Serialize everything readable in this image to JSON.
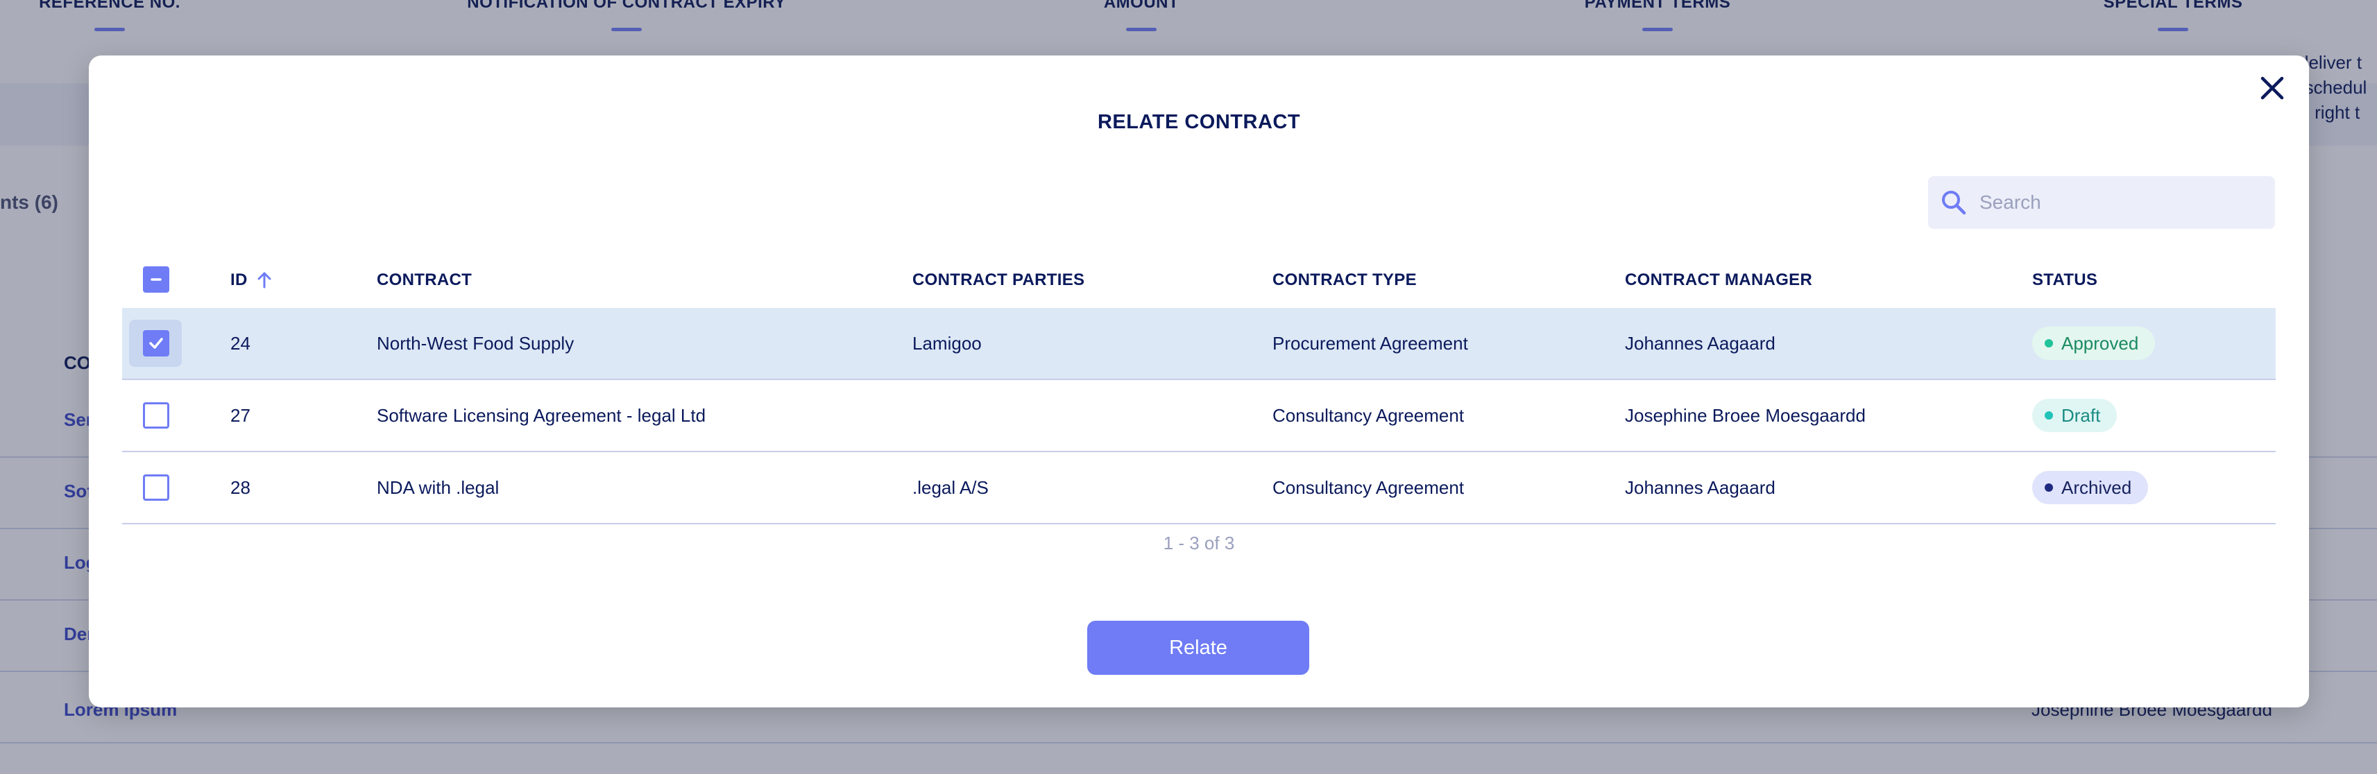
{
  "background": {
    "columns": [
      {
        "label": "REFERENCE NO.",
        "center": "158px"
      },
      {
        "label": "NOTIFICATION OF CONTRACT EXPIRY",
        "center": "903px"
      },
      {
        "label": "AMOUNT",
        "center": "1645px"
      },
      {
        "label": "PAYMENT TERMS",
        "center": "2389px"
      },
      {
        "label": "SPECIAL TERMS",
        "center": "3132px"
      }
    ],
    "special_terms_lines": [
      "l deliver t",
      "d schedul",
      "he right t"
    ],
    "tab_label": "nts (6)",
    "table_col_header": "CO",
    "row_links": [
      "Sen",
      "Sof",
      "Log",
      "Der",
      "Lorem ipsum"
    ],
    "last_row_manager": "Josephine Broee Moesgaardd"
  },
  "modal": {
    "title": "RELATE CONTRACT",
    "close_icon": "close-icon",
    "search": {
      "placeholder": "Search",
      "value": "",
      "icon": "search-icon"
    },
    "columns": {
      "id": "ID",
      "contract": "CONTRACT",
      "parties": "CONTRACT PARTIES",
      "type": "CONTRACT TYPE",
      "manager": "CONTRACT MANAGER",
      "status": "STATUS"
    },
    "sort": {
      "column": "id",
      "direction": "ascending",
      "icon": "arrow-up-icon"
    },
    "rows": [
      {
        "id": "24",
        "contract": "North-West Food Supply",
        "parties": "Lamigoo",
        "type": "Procurement Agreement",
        "manager": "Johannes Aagaard",
        "status": "Approved",
        "selected": true
      },
      {
        "id": "27",
        "contract": "Software Licensing Agreement - legal Ltd",
        "parties": "",
        "type": "Consultancy Agreement",
        "manager": "Josephine Broee Moesgaardd",
        "status": "Draft",
        "selected": false
      },
      {
        "id": "28",
        "contract": "NDA with .legal",
        "parties": ".legal A/S",
        "type": "Consultancy Agreement",
        "manager": "Johannes Aagaard",
        "status": "Archived",
        "selected": false
      }
    ],
    "pagination": "1 - 3 of 3",
    "relate_button": "Relate"
  },
  "colors": {
    "accent": "#6f7cf5",
    "text_primary": "#0b1a5c",
    "selected_row": "#dde8f6",
    "status_approved": "#22c39a",
    "status_draft": "#21c3b9",
    "status_archived": "#1e2a80"
  }
}
